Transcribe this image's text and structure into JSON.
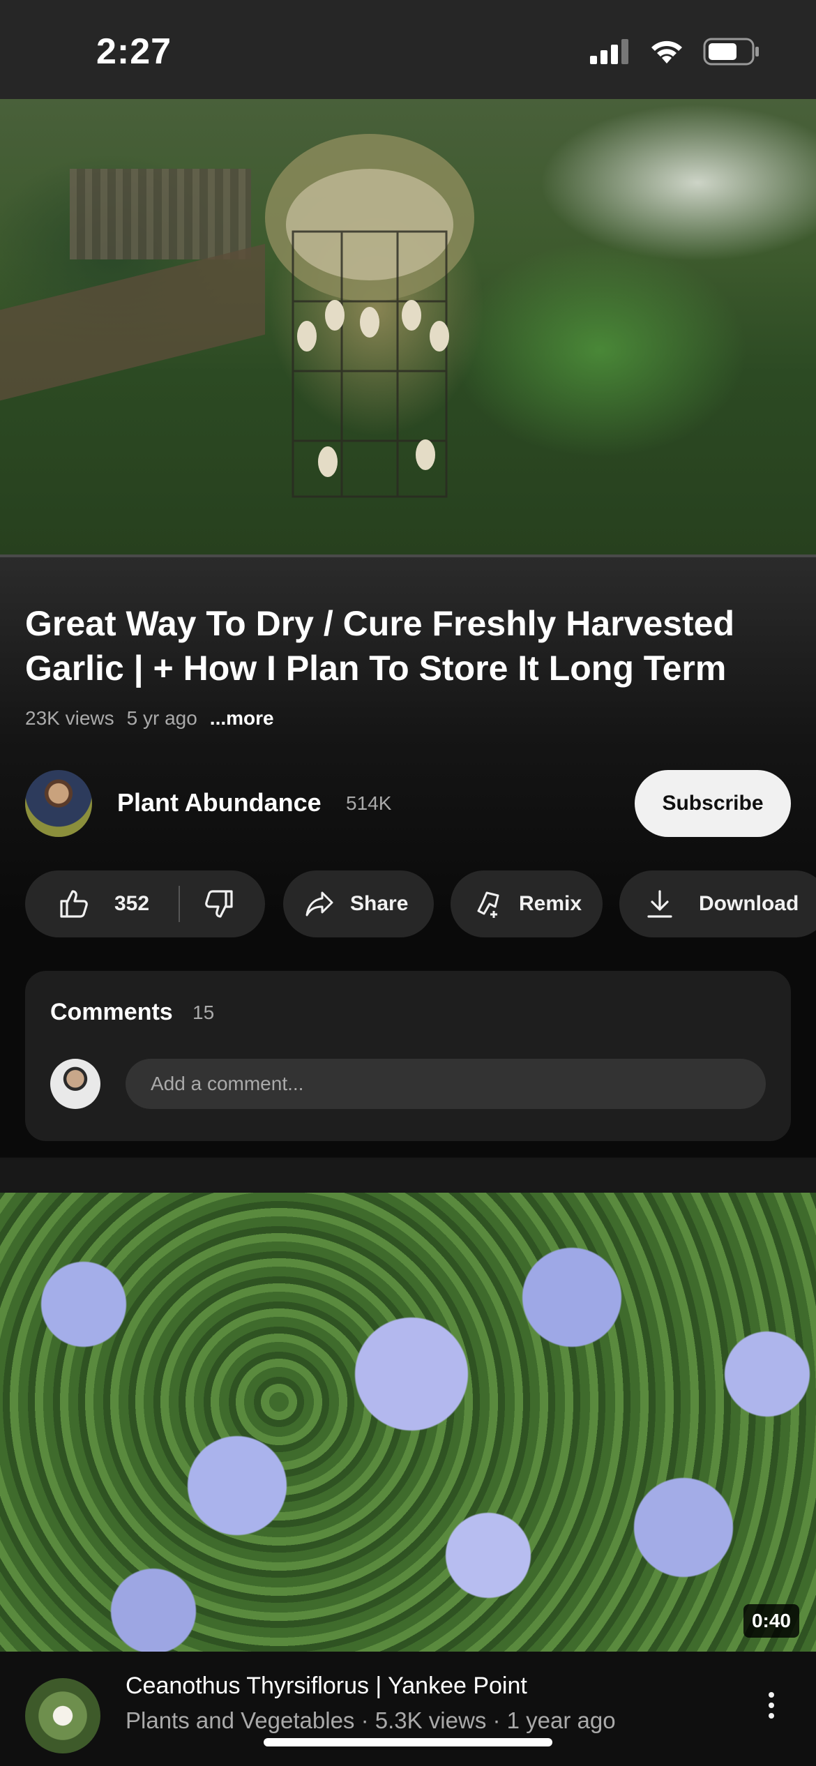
{
  "status_bar": {
    "time": "2:27"
  },
  "video": {
    "title": "Great Way To Dry / Cure Freshly Harvested Garlic | + How I Plan To Store It Long Term",
    "views": "23K views",
    "age": "5 yr ago",
    "more_label": "...more"
  },
  "channel": {
    "name": "Plant Abundance",
    "subscribers": "514K",
    "subscribe_label": "Subscribe"
  },
  "actions": {
    "likes": "352",
    "share_label": "Share",
    "remix_label": "Remix",
    "download_label": "Download"
  },
  "comments": {
    "title": "Comments",
    "count": "15",
    "placeholder": "Add a comment..."
  },
  "next_video": {
    "duration": "0:40",
    "title": "Ceanothus Thyrsiflorus | Yankee Point",
    "meta": "Plants and Vegetables  · 5.3K views · 1 year ago"
  },
  "colors": {
    "background": "#0f0f0f",
    "pill": "#272727",
    "subscribe_bg": "#f1f1f1",
    "secondary_text": "#aaaaaa"
  }
}
